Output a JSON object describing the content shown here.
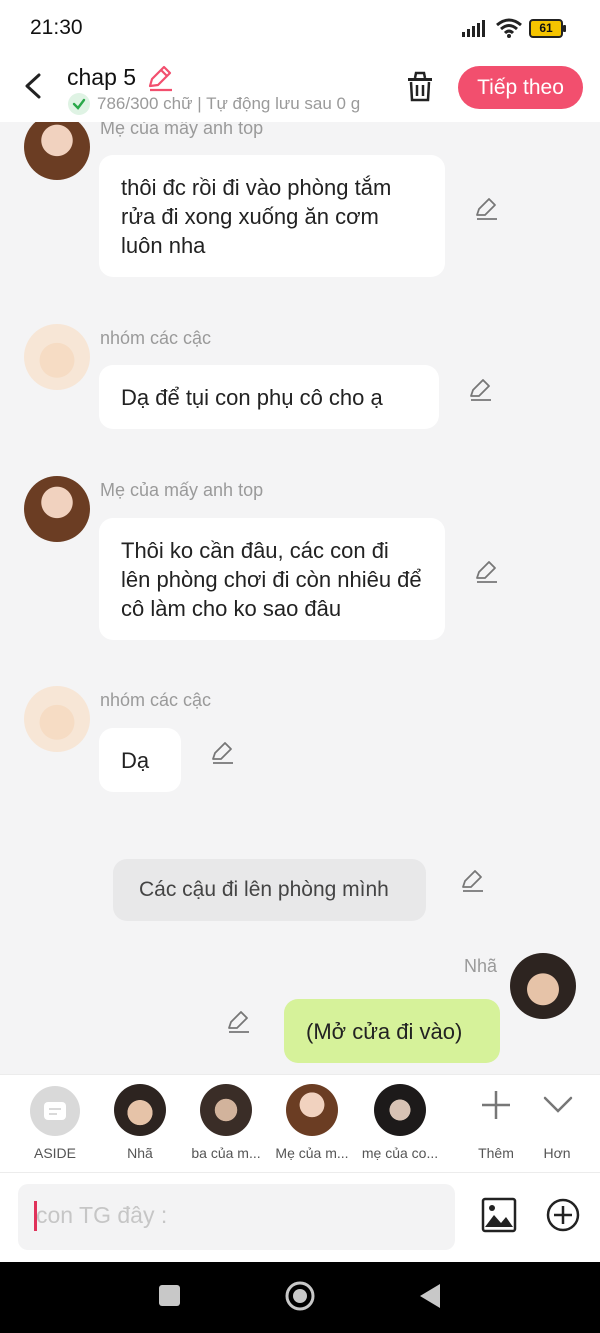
{
  "status_bar": {
    "time": "21:30",
    "battery": "61"
  },
  "header": {
    "title": "chap 5",
    "subtitle": "786/300 chữ | Tự động lưu sau 0 g",
    "next_label": "Tiếp theo"
  },
  "messages": [
    {
      "speaker": "Mẹ của mấy anh top",
      "text": "thôi đc rồi đi vào phòng tắm rửa đi xong xuống ăn cơm luôn nha"
    },
    {
      "speaker": "nhóm các cậc",
      "text": "Dạ để tụi con phụ cô cho ạ"
    },
    {
      "speaker": "Mẹ của mấy anh top",
      "text": "Thôi ko cần đâu, các con đi lên phòng chơi đi còn nhiêu để cô làm cho ko sao đâu"
    },
    {
      "speaker": "nhóm các cậc",
      "text": "Dạ"
    },
    {
      "speaker": "",
      "text": "Các cậu đi lên phòng mình"
    },
    {
      "speaker": "Nhã",
      "text": "(Mở cửa đi vào)"
    }
  ],
  "characters": [
    {
      "label": "ASIDE"
    },
    {
      "label": "Nhã"
    },
    {
      "label": "ba của m..."
    },
    {
      "label": "Mẹ của m..."
    },
    {
      "label": "mẹ của co..."
    },
    {
      "label": "Thêm"
    },
    {
      "label": "Hơn"
    }
  ],
  "input": {
    "placeholder": "con TG đây :"
  },
  "colors": {
    "accent": "#f24f6e",
    "right_bubble": "#d6f29a",
    "narration_bubble": "#e8e8e9",
    "background": "#f4f4f5"
  }
}
